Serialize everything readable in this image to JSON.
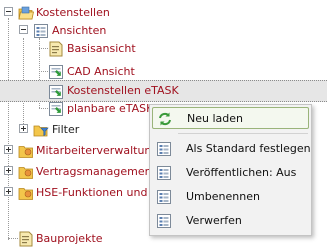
{
  "tree": {
    "root": {
      "label": "Kostenstellen"
    },
    "views_folder": {
      "label": "Ansichten"
    },
    "views": [
      {
        "label": "Basisansicht"
      },
      {
        "label": "CAD Ansicht"
      },
      {
        "label": "Kostenstellen eTASK"
      },
      {
        "label": "planbare eTASK"
      }
    ],
    "filter": {
      "label": "Filter"
    },
    "others": [
      {
        "label": "Mitarbeiterverwaltung"
      },
      {
        "label": "Vertragsmanagement"
      },
      {
        "label": "HSE-Funktionen und Be"
      },
      {
        "label": "Bauprojekte"
      }
    ]
  },
  "context_menu": {
    "items": [
      {
        "label": "Neu laden",
        "icon": "refresh-icon"
      },
      {
        "label": "Als Standard festlegen",
        "icon": "grid-icon"
      },
      {
        "label": "Veröffentlichen: Aus",
        "icon": "grid-icon"
      },
      {
        "label": "Umbenennen",
        "icon": "grid-icon"
      },
      {
        "label": "Verwerfen",
        "icon": "grid-icon"
      }
    ]
  },
  "colors": {
    "accent_red": "#a0111f",
    "selection": "#e6e6e6",
    "menu_highlight_border": "#9ab47a"
  }
}
